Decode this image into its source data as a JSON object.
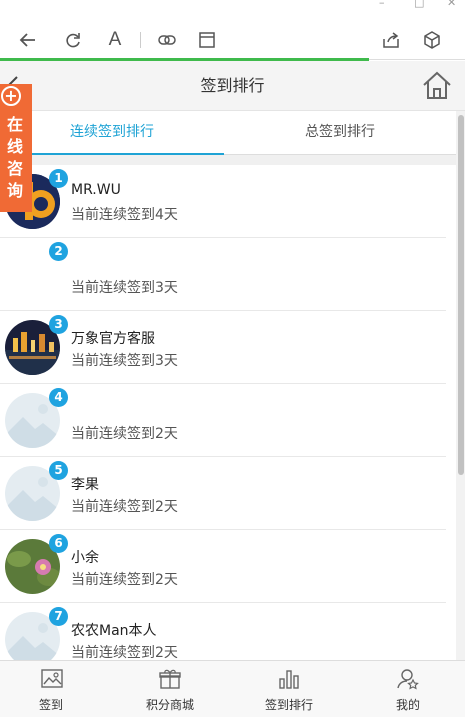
{
  "browser": {
    "window_controls": [
      "–",
      "□",
      "✕"
    ],
    "icons": [
      "back-arrow-icon",
      "reload-icon",
      "font-icon",
      "link-icon",
      "window-icon",
      "share-icon",
      "cube-icon"
    ],
    "font_icon_glyph": "A"
  },
  "header": {
    "title": "签到排行",
    "back_icon": "chevron-left-icon",
    "home_icon": "home-icon"
  },
  "tabs": [
    {
      "label": "连续签到排行",
      "active": true
    },
    {
      "label": "总签到排行",
      "active": false
    }
  ],
  "consult": {
    "plus": "+",
    "label": "在线咨询"
  },
  "accent_color": "#1fa3d5",
  "consult_color": "#f06a35",
  "rankings": [
    {
      "rank": "1",
      "name": "MR.WU",
      "days": "当前连续签到4天",
      "avatar": "logo"
    },
    {
      "rank": "2",
      "name": "",
      "days": "当前连续签到3天",
      "avatar": "blank"
    },
    {
      "rank": "3",
      "name": "万象官方客服",
      "days": "当前连续签到3天",
      "avatar": "city-night"
    },
    {
      "rank": "4",
      "name": "",
      "days": "当前连续签到2天",
      "avatar": "placeholder"
    },
    {
      "rank": "5",
      "name": "李果",
      "days": "当前连续签到2天",
      "avatar": "placeholder"
    },
    {
      "rank": "6",
      "name": "小余",
      "days": "当前连续签到2天",
      "avatar": "flower"
    },
    {
      "rank": "7",
      "name": "农农Man本人",
      "days": "当前连续签到2天",
      "avatar": "placeholder"
    }
  ],
  "bottom_nav": [
    {
      "label": "签到",
      "icon": "picture-icon"
    },
    {
      "label": "积分商城",
      "icon": "gift-icon"
    },
    {
      "label": "签到排行",
      "icon": "bar-chart-icon"
    },
    {
      "label": "我的",
      "icon": "user-star-icon"
    }
  ]
}
